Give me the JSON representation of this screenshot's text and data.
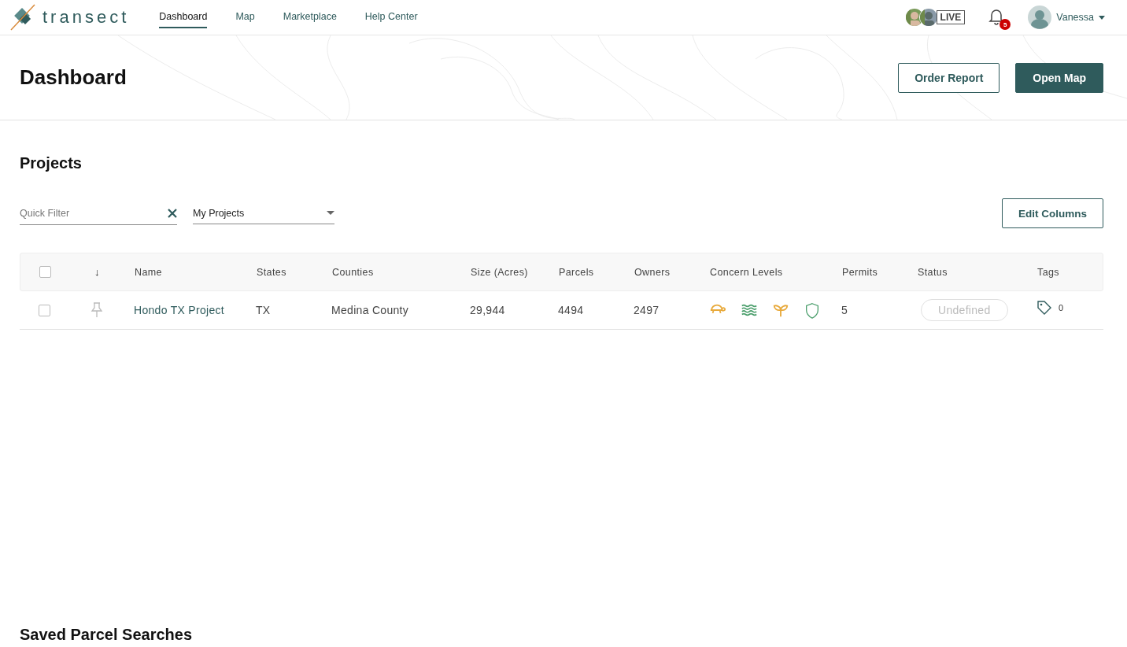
{
  "brand": {
    "name": "transect"
  },
  "nav": [
    {
      "label": "Dashboard",
      "selected": true
    },
    {
      "label": "Map",
      "selected": false
    },
    {
      "label": "Marketplace",
      "selected": false
    },
    {
      "label": "Help Center",
      "selected": false
    }
  ],
  "live_badge": "LIVE",
  "notifications": {
    "count": "5"
  },
  "user": {
    "name": "Vanessa"
  },
  "page": {
    "title": "Dashboard",
    "buttons": [
      {
        "label": "Order Report",
        "kind": "outline"
      },
      {
        "label": "Open Map",
        "kind": "primary"
      }
    ]
  },
  "projects": {
    "title": "Projects",
    "filter": {
      "placeholder": "Quick Filter"
    },
    "dropdown": {
      "value": "My Projects"
    },
    "edit_columns": "Edit Columns",
    "sort_icon": "↓",
    "select_all_checked": false,
    "columns": [
      "Name",
      "States",
      "Counties",
      "Size (Acres)",
      "Parcels",
      "Owners",
      "Concern Levels",
      "Permits",
      "Status",
      "Tags"
    ],
    "rows": [
      {
        "checked": false,
        "pinned": false,
        "name": "Hondo TX Project",
        "states": "TX",
        "counties": "Medina County",
        "size": "29,944",
        "parcels": "4494",
        "owners": "2497",
        "concerns": [
          {
            "kind": "turtle",
            "color": "#e8a93a"
          },
          {
            "kind": "water",
            "color": "#4a9e6b"
          },
          {
            "kind": "sprout",
            "color": "#e8a93a"
          },
          {
            "kind": "shield",
            "color": "#4a9e6b"
          }
        ],
        "permits": "5",
        "status": "Undefined",
        "tags": "0"
      }
    ]
  },
  "saved_searches": {
    "title": "Saved Parcel Searches"
  }
}
